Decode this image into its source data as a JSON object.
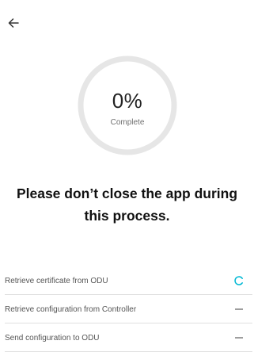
{
  "header": {
    "back_icon": "arrow-left-icon"
  },
  "progress": {
    "value_text": "0%",
    "value": 0,
    "label": "Complete",
    "track_color": "#e6e6e6",
    "fill_color": "#00bcd4"
  },
  "message": {
    "line1": "Please don’t close the app during",
    "line2": "this process."
  },
  "steps": [
    {
      "label": "Retrieve certificate from ODU",
      "status": "in-progress",
      "status_icon": "spinner-icon",
      "accent": "#00b8d4"
    },
    {
      "label": "Retrieve configuration from Controller",
      "status": "pending",
      "status_icon": "dash-icon"
    },
    {
      "label": "Send configuration to ODU",
      "status": "pending",
      "status_icon": "dash-icon"
    }
  ]
}
